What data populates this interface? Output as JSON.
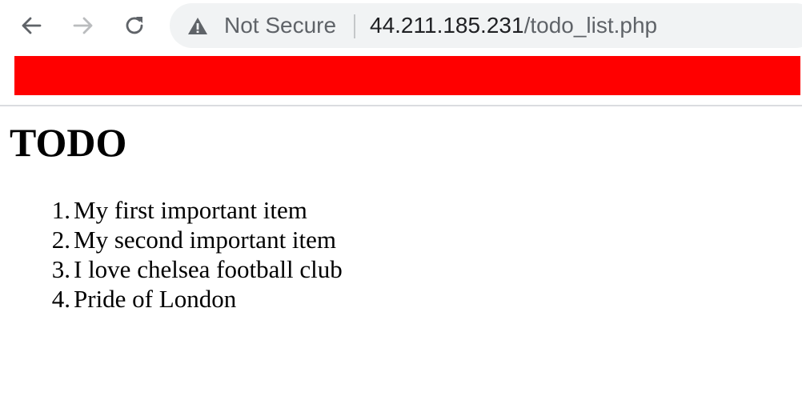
{
  "browser": {
    "security_label": "Not Secure",
    "url_host": "44.211.185.231",
    "url_path": "/todo_list.php",
    "banner_color": "#ff0000",
    "icons": {
      "back": "back-arrow-icon",
      "forward": "forward-arrow-icon",
      "reload": "reload-icon",
      "security": "warning-triangle-icon"
    }
  },
  "page": {
    "title": "TODO",
    "items": [
      {
        "number": "1.",
        "text": "My first important item"
      },
      {
        "number": "2.",
        "text": "My second important item"
      },
      {
        "number": "3.",
        "text": "I love chelsea football club"
      },
      {
        "number": "4.",
        "text": "Pride of London"
      }
    ]
  }
}
